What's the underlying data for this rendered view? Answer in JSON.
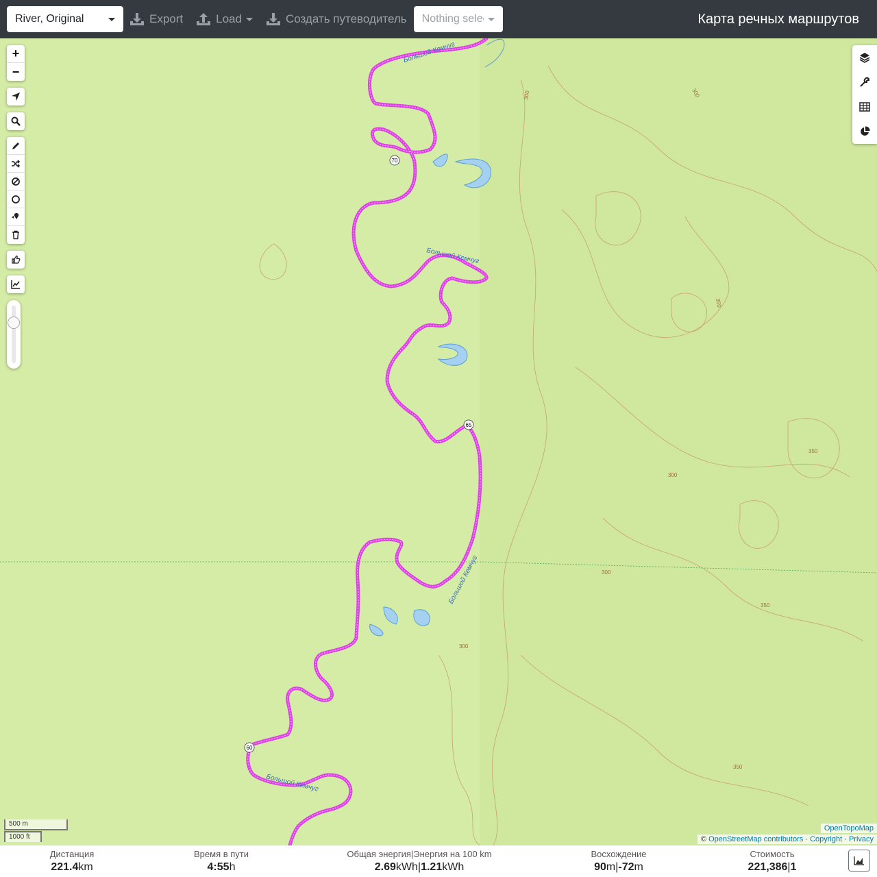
{
  "navbar": {
    "profile": "River, Original",
    "export_label": "Export",
    "load_label": "Load",
    "guide_label": "Создать путеводитель",
    "selection_placeholder": "Nothing selected",
    "brand": "Карта речных маршрутов"
  },
  "map": {
    "river_name": "Большой Кемчуг",
    "km_markers": [
      "70",
      "65",
      "60"
    ],
    "contour_labels": [
      "300",
      "350"
    ],
    "scale": {
      "metric": "500 m",
      "imperial": "1000 ft"
    },
    "attribution": {
      "provider": "OpenTopoMap",
      "prefix": "©",
      "osm": "OpenStreetMap contributors",
      "copyright": "Copyright",
      "privacy": "Privacy",
      "sep": "·"
    },
    "colors": {
      "route": "#e040e8",
      "water": "#a6d0f0",
      "land": "#d4eca6",
      "contour": "#b97a4a"
    }
  },
  "toolbar": {
    "zoom_in": "+",
    "zoom_out": "−",
    "icons": [
      "locate-icon",
      "search-icon",
      "pencil-icon",
      "shuffle-icon",
      "ban-icon",
      "circle-icon",
      "marker-icon",
      "trash-icon",
      "hand-icon",
      "chart-line-icon"
    ]
  },
  "right_toolbar": {
    "icons": [
      "layers-icon",
      "wrench-icon",
      "table-icon",
      "pie-chart-icon"
    ]
  },
  "stats": {
    "distance": {
      "label": "Дистанция",
      "value": "221.4",
      "unit": "km"
    },
    "time": {
      "label": "Время в пути",
      "value": "4:55",
      "unit": "h"
    },
    "energy": {
      "label": "Общая энергия",
      "label2": "Энергия на 100 km",
      "value": "2.69",
      "unit": "kWh",
      "value2": "1.21",
      "unit2": "kWh",
      "sep": "|"
    },
    "ascent": {
      "label": "Восхождение",
      "value": "90",
      "unit": "m",
      "value2": "-72",
      "unit2": "m",
      "sep": "|"
    },
    "cost": {
      "label": "Стоимость",
      "value": "221,386",
      "value2": "1",
      "sep": "|"
    }
  }
}
